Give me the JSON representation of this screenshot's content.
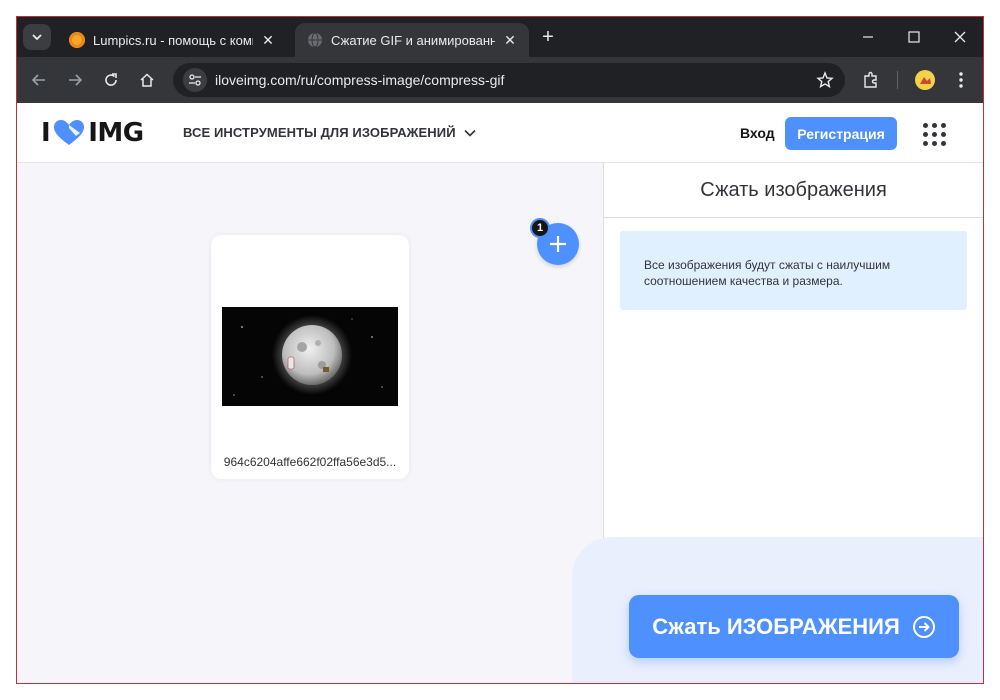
{
  "browser": {
    "tabs": [
      {
        "title": "Lumpics.ru - помощь с компью",
        "active": false
      },
      {
        "title": "Сжатие GIF и анимированный",
        "active": true
      }
    ],
    "url": "iloveimg.com/ru/compress-image/compress-gif"
  },
  "site": {
    "logo_left": "I",
    "logo_right": "IMG",
    "tools_menu": "ВСЕ ИНСТРУМЕНТЫ ДЛЯ ИЗОБРАЖЕНИЙ",
    "login": "Вход",
    "signup": "Регистрация"
  },
  "work": {
    "file_count": "1",
    "file_name": "964c6204affe662f02ffa56e3d5..."
  },
  "sidebar": {
    "title": "Сжать изображения",
    "info": "Все изображения будут сжаты с наилучшим соотношением качества и размера.",
    "action": "Сжать ИЗОБРАЖЕНИЯ"
  },
  "colors": {
    "accent": "#4d90fe",
    "brand_dark": "#161616",
    "info_bg": "#e0f0ff"
  }
}
